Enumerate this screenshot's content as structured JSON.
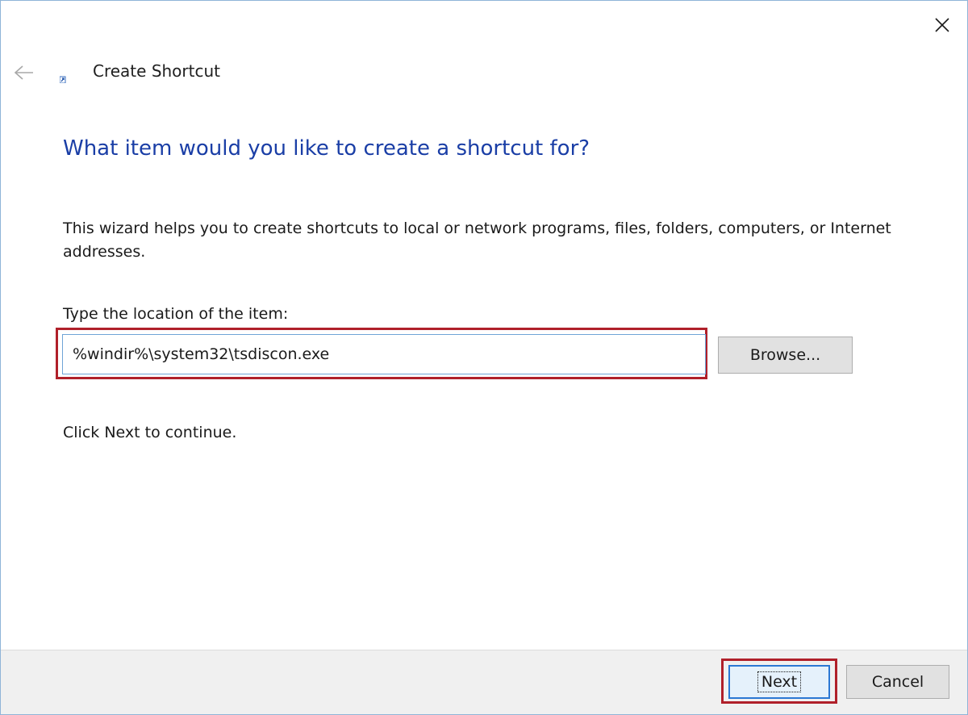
{
  "window": {
    "title": "Create Shortcut",
    "accent_color": "#1a3ea6",
    "highlight_color": "#b0202a"
  },
  "controls": {
    "close_icon": "close-icon",
    "back_icon": "back-arrow-icon",
    "title_icon": "shortcut-icon"
  },
  "content": {
    "heading": "What item would you like to create a shortcut for?",
    "description": "This wizard helps you to create shortcuts to local or network programs, files, folders, computers, or Internet addresses.",
    "location_label": "Type the location of the item:",
    "location_value": "%windir%\\system32\\tsdiscon.exe",
    "browse_label": "Browse...",
    "continue_text": "Click Next to continue."
  },
  "footer": {
    "next_label": "Next",
    "cancel_label": "Cancel"
  }
}
